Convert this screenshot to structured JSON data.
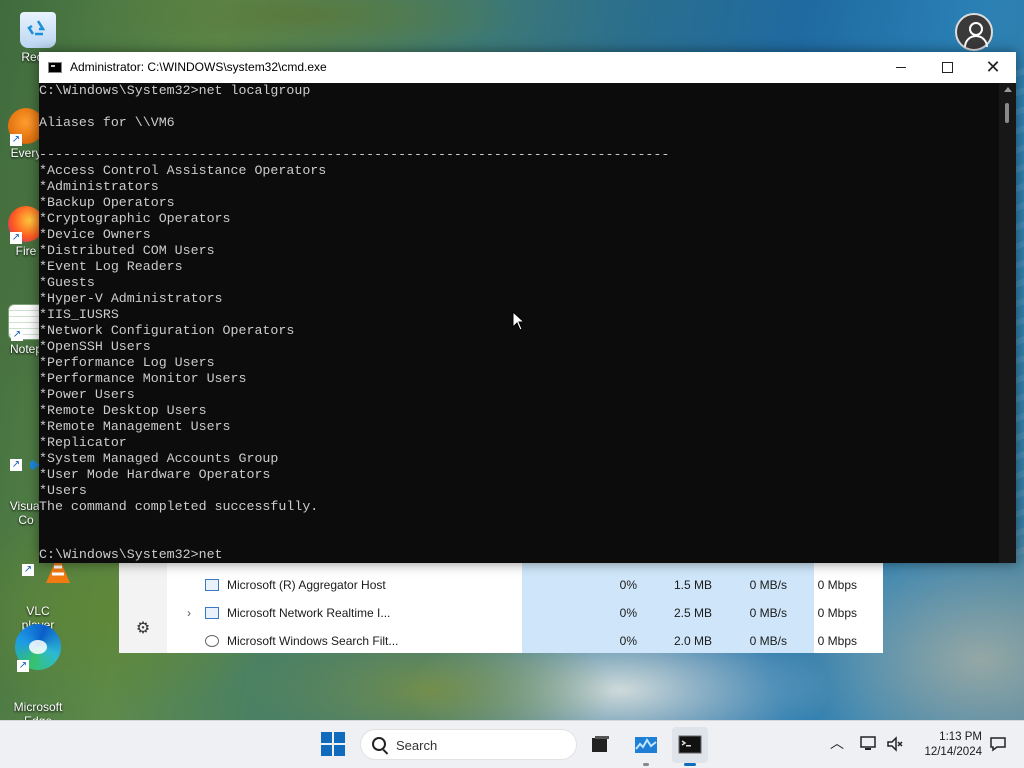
{
  "desktop": {
    "icons": [
      {
        "label": "Recyc",
        "icon": "recycle-bin-icon"
      },
      {
        "label": "Every",
        "icon": "everything-icon"
      },
      {
        "label": "Fire",
        "icon": "firefox-icon"
      },
      {
        "label": "Notep",
        "icon": "notepad-icon"
      },
      {
        "label": "Visual\nCo",
        "icon": "vscode-icon"
      },
      {
        "label": "VLC\nplayer",
        "icon": "vlc-icon"
      },
      {
        "label": "Microsoft\nEdge",
        "icon": "edge-icon"
      }
    ]
  },
  "cmd": {
    "title": "Administrator: C:\\WINDOWS\\system32\\cmd.exe",
    "lines": [
      "C:\\Windows\\System32>net localgroup",
      "",
      "Aliases for \\\\VM6",
      "",
      "-------------------------------------------------------------------------------",
      "*Access Control Assistance Operators",
      "*Administrators",
      "*Backup Operators",
      "*Cryptographic Operators",
      "*Device Owners",
      "*Distributed COM Users",
      "*Event Log Readers",
      "*Guests",
      "*Hyper-V Administrators",
      "*IIS_IUSRS",
      "*Network Configuration Operators",
      "*OpenSSH Users",
      "*Performance Log Users",
      "*Performance Monitor Users",
      "*Power Users",
      "*Remote Desktop Users",
      "*Remote Management Users",
      "*Replicator",
      "*System Managed Accounts Group",
      "*User Mode Hardware Operators",
      "*Users",
      "The command completed successfully.",
      "",
      "",
      "C:\\Windows\\System32>net"
    ]
  },
  "taskmgr": {
    "rows": [
      {
        "expand": "",
        "name": "Microsoft (R) Aggregator Host",
        "cpu": "0%",
        "memory": "1.5 MB",
        "disk": "0 MB/s",
        "network": "0 Mbps",
        "icon": "app-window-icon"
      },
      {
        "expand": "›",
        "name": "Microsoft Network Realtime I...",
        "cpu": "0%",
        "memory": "2.5 MB",
        "disk": "0 MB/s",
        "network": "0 Mbps",
        "icon": "app-window-icon"
      },
      {
        "expand": "",
        "name": "Microsoft Windows Search Filt...",
        "cpu": "0%",
        "memory": "2.0 MB",
        "disk": "0 MB/s",
        "network": "0 Mbps",
        "icon": "search-filter-icon"
      }
    ]
  },
  "taskbar": {
    "search_placeholder": "Search",
    "time": "1:13 PM",
    "date": "12/14/2024"
  }
}
